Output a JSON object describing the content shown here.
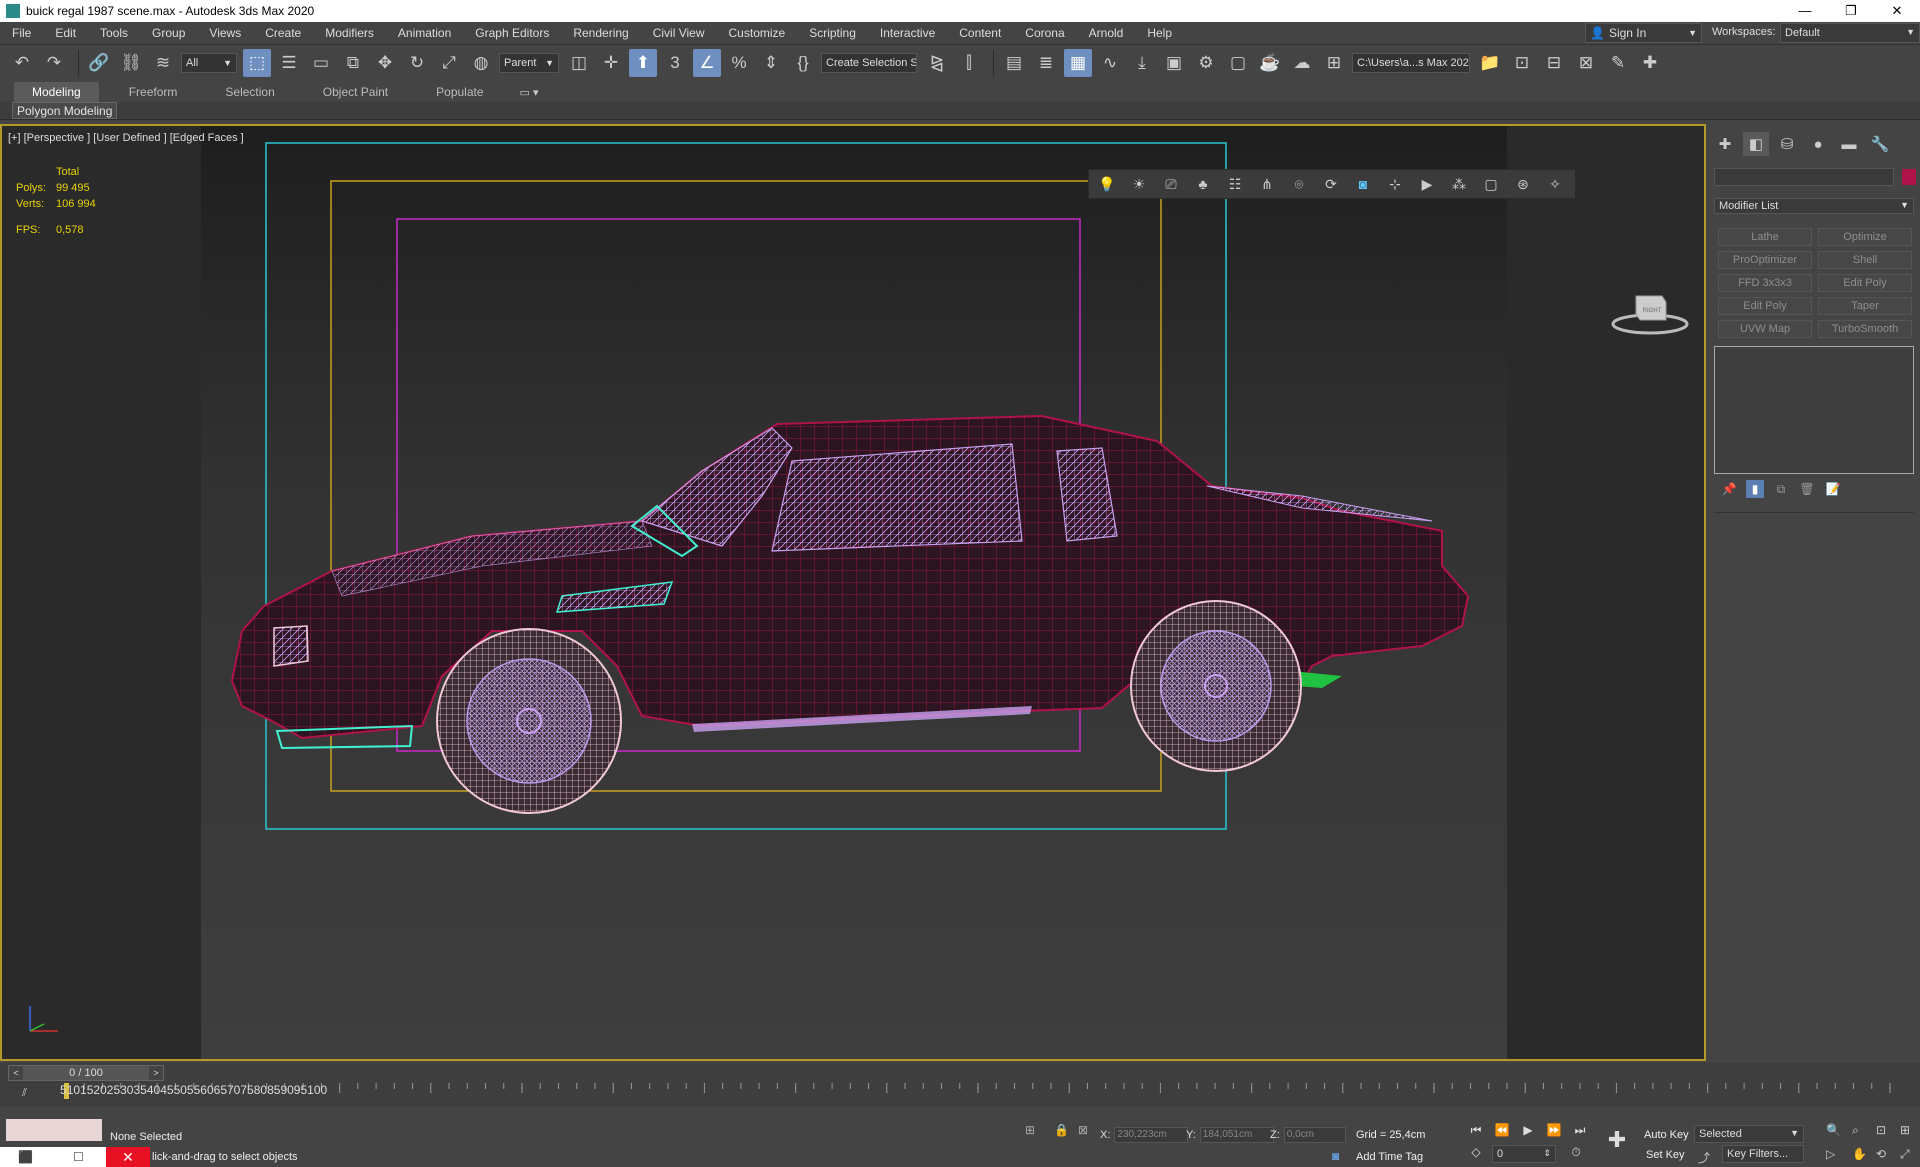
{
  "window": {
    "title": "buick regal 1987 scene.max - Autodesk 3ds Max 2020",
    "minimize": "—",
    "maximize": "❐",
    "close": "✕"
  },
  "menu": {
    "items": [
      "File",
      "Edit",
      "Tools",
      "Group",
      "Views",
      "Create",
      "Modifiers",
      "Animation",
      "Graph Editors",
      "Rendering",
      "Civil View",
      "Customize",
      "Scripting",
      "Interactive",
      "Content",
      "Corona",
      "Arnold",
      "Help"
    ],
    "sign_in": "Sign In",
    "workspaces_label": "Workspaces:",
    "workspace_value": "Default"
  },
  "toolbar": {
    "filter_value": "All",
    "reference_value": "Parent",
    "selection_set": "Create Selection Se",
    "project_path": "C:\\Users\\a...s Max 2020"
  },
  "ribbon": {
    "tabs": [
      "Modeling",
      "Freeform",
      "Selection",
      "Object Paint",
      "Populate"
    ],
    "active_panel": "Polygon Modeling"
  },
  "viewport": {
    "label": "[+] [Perspective ] [User Defined ] [Edged Faces ]",
    "stats_header": "Total",
    "polys_label": "Polys:",
    "polys_value": "99 495",
    "verts_label": "Verts:",
    "verts_value": "106 994",
    "fps_label": "FPS:",
    "fps_value": "0,578",
    "viewcube_label": "RIGHT"
  },
  "command_panel": {
    "modifier_list": "Modifier List",
    "modifier_buttons": [
      "Lathe",
      "Optimize",
      "ProOptimizer",
      "Shell",
      "FFD 3x3x3",
      "Edit Poly",
      "Edit Poly",
      "Taper",
      "UVW Map",
      "TurboSmooth"
    ],
    "object_color": "#b0124a"
  },
  "timeline": {
    "frame_display": "0 / 100",
    "ticks": [
      "5",
      "10",
      "15",
      "20",
      "25",
      "30",
      "35",
      "40",
      "45",
      "50",
      "55",
      "60",
      "65",
      "70",
      "75",
      "80",
      "85",
      "90",
      "95",
      "100"
    ]
  },
  "status": {
    "selection": "None Selected",
    "prompt": "lick-and-drag to select objects",
    "x_label": "X:",
    "x_value": "230,223cm",
    "y_label": "Y:",
    "y_value": "184,051cm",
    "z_label": "Z:",
    "z_value": "0,0cm",
    "grid": "Grid = 25,4cm",
    "add_time_tag": "Add Time Tag",
    "auto_key": "Auto Key",
    "set_key": "Set Key",
    "key_mode": "Selected",
    "key_filters": "Key Filters...",
    "current_frame": "0"
  },
  "colors": {
    "wire_body": "#b0124a",
    "wire_glass": "#c9a0f0",
    "safe_frame_outer": "#27c7d0",
    "safe_frame_mid": "#c8a020",
    "safe_frame_inner": "#c828c8",
    "viewport_border": "#b39a2a"
  }
}
